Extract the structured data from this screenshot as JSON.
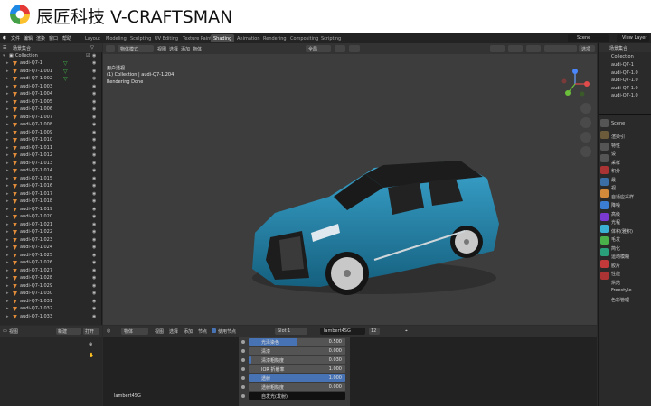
{
  "brand": {
    "text": "辰匠科技  V-CRAFTSMAN"
  },
  "menu": [
    "文件",
    "编辑",
    "渲染",
    "窗口",
    "帮助"
  ],
  "workspaces": [
    "Layout",
    "Modeling",
    "Sculpting",
    "UV Editing",
    "Texture Paint",
    "Shading",
    "Animation",
    "Rendering",
    "Compositing",
    "Scripting"
  ],
  "active_workspace": "Shading",
  "scene": "Scene",
  "view_layer": "View Layer",
  "outliner": {
    "title": "场景集合",
    "collection": "Collection",
    "items": [
      "audi-Q7-1",
      "audi-Q7-1.001",
      "audi-Q7-1.002",
      "audi-Q7-1.003",
      "audi-Q7-1.004",
      "audi-Q7-1.005",
      "audi-Q7-1.006",
      "audi-Q7-1.007",
      "audi-Q7-1.008",
      "audi-Q7-1.009",
      "audi-Q7-1.010",
      "audi-Q7-1.011",
      "audi-Q7-1.012",
      "audi-Q7-1.013",
      "audi-Q7-1.014",
      "audi-Q7-1.015",
      "audi-Q7-1.016",
      "audi-Q7-1.017",
      "audi-Q7-1.018",
      "audi-Q7-1.019",
      "audi-Q7-1.020",
      "audi-Q7-1.021",
      "audi-Q7-1.022",
      "audi-Q7-1.023",
      "audi-Q7-1.024",
      "audi-Q7-1.025",
      "audi-Q7-1.026",
      "audi-Q7-1.027",
      "audi-Q7-1.028",
      "audi-Q7-1.029",
      "audi-Q7-1.030",
      "audi-Q7-1.031",
      "audi-Q7-1.032",
      "audi-Q7-1.033"
    ]
  },
  "viewport": {
    "mode": "物体模式",
    "menu": [
      "视图",
      "选择",
      "添加",
      "物体"
    ],
    "transform": "全局",
    "options": "选项",
    "info_line1": "用户透视",
    "info_line2": "(1) Collection | audi-Q7-1.204",
    "info_line3": "Rendering Done"
  },
  "right_outliner": {
    "title": "场景集合",
    "collection": "Collection",
    "items": [
      "audi-Q7-1",
      "audi-Q7-1.0",
      "audi-Q7-1.0",
      "audi-Q7-1.0",
      "audi-Q7-1.0"
    ]
  },
  "properties": {
    "scene": "Scene",
    "rows": [
      "渲染引",
      "特性",
      "设",
      "采样",
      "积分",
      "最",
      "视",
      "自适应采样",
      "降噪",
      "高级",
      "光程",
      "体积(雅积)",
      "毛发",
      "简化",
      "运动模糊",
      "胶片",
      "性能",
      "烘焙",
      "Freestyle",
      "色彩管理"
    ]
  },
  "node_editor": {
    "object": "物体",
    "menu": [
      "视图",
      "选择",
      "添加",
      "节点"
    ],
    "use_nodes": "使用节点",
    "slot": "Slot 1",
    "material": "lambert4SG",
    "users": "12",
    "node_label": "lambert4SG",
    "rows": [
      {
        "label": "光泽染色",
        "value": "0.500",
        "fill": 0.5
      },
      {
        "label": "清漆",
        "value": "0.000",
        "fill": 0
      },
      {
        "label": "清漆粗糙度",
        "value": "0.030",
        "fill": 0.03
      },
      {
        "label": "IOR 折射率",
        "value": "1.000",
        "fill": 0
      },
      {
        "label": "透射",
        "value": "1.000",
        "fill": 1
      },
      {
        "label": "透射粗糙度",
        "value": "0.000",
        "fill": 0
      },
      {
        "label": "自发光(发射)",
        "value": "",
        "fill": 0
      }
    ]
  },
  "bottom_left": {
    "view": "视图",
    "new": "新建",
    "open": "打开"
  },
  "colors": {
    "car_body": "#1f7ea6",
    "accent": "#4772b3",
    "object_icon": "#e08b3a"
  }
}
